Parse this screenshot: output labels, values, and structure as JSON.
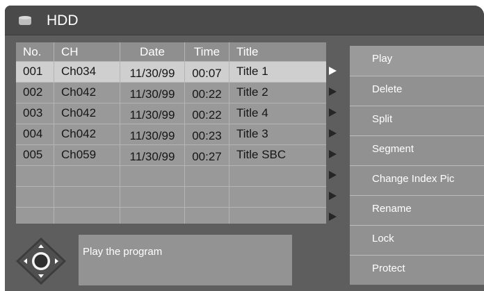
{
  "header": {
    "title": "HDD",
    "icon": "hdd-icon"
  },
  "table": {
    "columns": [
      "No.",
      "CH",
      "Date",
      "Time",
      "Title"
    ],
    "rows": [
      {
        "no": "001",
        "ch": "Ch034",
        "date": "11/30/99",
        "time": "00:07",
        "title": "Title 1"
      },
      {
        "no": "002",
        "ch": "Ch042",
        "date": "11/30/99",
        "time": "00:22",
        "title": "Title 2"
      },
      {
        "no": "003",
        "ch": "Ch042",
        "date": "11/30/99",
        "time": "00:22",
        "title": "Title 4"
      },
      {
        "no": "004",
        "ch": "Ch042",
        "date": "11/30/99",
        "time": "00:23",
        "title": "Title 3"
      },
      {
        "no": "005",
        "ch": "Ch059",
        "date": "11/30/99",
        "time": "00:27",
        "title": "Title SBC"
      }
    ],
    "empty_rows": 3,
    "selected_row": 0
  },
  "menu": {
    "items": [
      "Play",
      "Delete",
      "Split",
      "Segment",
      "Change Index Pic",
      "Rename",
      "Lock",
      "Protect"
    ]
  },
  "help": {
    "text": "Play the program"
  },
  "colors": {
    "screen_bg": "#5e5e5e",
    "row_bg": "#999999",
    "selected_row_bg": "#cfcfcf",
    "menu_bg": "#919191"
  }
}
